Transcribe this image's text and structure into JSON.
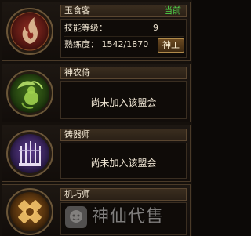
{
  "professions": [
    {
      "name": "玉食客",
      "status": "当前",
      "skill_level_label": "技能等级：",
      "skill_level_value": "9",
      "proficiency_label": "熟练度：",
      "proficiency_value": "1542/1870",
      "master_button": "神工",
      "emblem_icon": "flame-emblem-icon"
    },
    {
      "name": "神农侍",
      "status_text": "尚未加入该盟会",
      "emblem_icon": "gourd-leaf-emblem-icon"
    },
    {
      "name": "铸器师",
      "status_text": "尚未加入该盟会",
      "emblem_icon": "weapon-rack-emblem-icon"
    },
    {
      "name": "机巧师",
      "emblem_icon": "gear-emblem-icon"
    }
  ],
  "watermark": {
    "text": "神仙代售",
    "icon": "watermark-logo-icon"
  },
  "colors": {
    "current_status": "#4fd34a",
    "text": "#f1e6d2",
    "border": "#4a3a28"
  }
}
